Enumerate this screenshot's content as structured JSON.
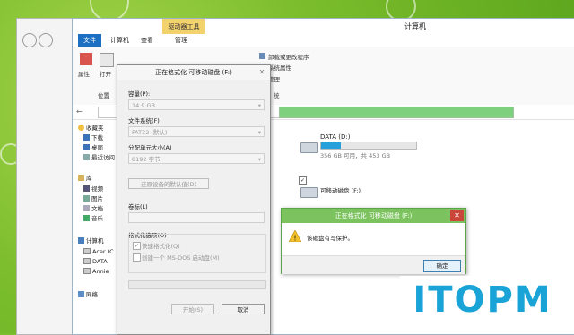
{
  "explorer": {
    "title": "计算机",
    "tools_tab": "驱动器工具",
    "tabs": [
      "文件",
      "计算机",
      "查看",
      "管理"
    ],
    "ribbon": {
      "properties": "属性",
      "open": "打开",
      "location_group": "位置",
      "uninstall": "卸载或更改程序",
      "system_props": "系统属性",
      "manage": "管理",
      "system_group": "统"
    },
    "nav": {
      "favorites": "收藏夹",
      "downloads": "下载",
      "desktop": "桌面",
      "recent": "最近访问",
      "libraries": "库",
      "videos": "视频",
      "pictures": "图片",
      "documents": "文档",
      "music": "音乐",
      "computer": "计算机",
      "drive_acer": "Acer (C",
      "drive_data": "DATA",
      "drive_annie": "Annie",
      "network": "网络"
    },
    "drives": {
      "data_name": "DATA (D:)",
      "data_space": "356 GB 可用，共 453 GB",
      "data_used_fraction": 0.21,
      "removable_name": "可移动磁盘 (F:)"
    }
  },
  "format_dialog": {
    "title": "正在格式化 可移动磁盘 (F:)",
    "capacity_label": "容量(P):",
    "capacity_value": "14.9 GB",
    "fs_label": "文件系统(F)",
    "fs_value": "FAT32 (默认)",
    "alloc_label": "分配单元大小(A)",
    "alloc_value": "8192 字节",
    "restore_btn": "还原设备的默认值(D)",
    "volume_label": "卷标(L)",
    "options_label": "格式化选项(O)",
    "quick_format": "快速格式化(Q)",
    "msdos_disk": "创建一个 MS-DOS 启动盘(M)",
    "start_btn": "开始(S)",
    "cancel_btn": "取消"
  },
  "alert": {
    "title": "正在格式化 可移动磁盘 (F:)",
    "message": "该磁盘有写保护。",
    "ok": "确定"
  },
  "brand": {
    "logo": "ITOPM"
  }
}
